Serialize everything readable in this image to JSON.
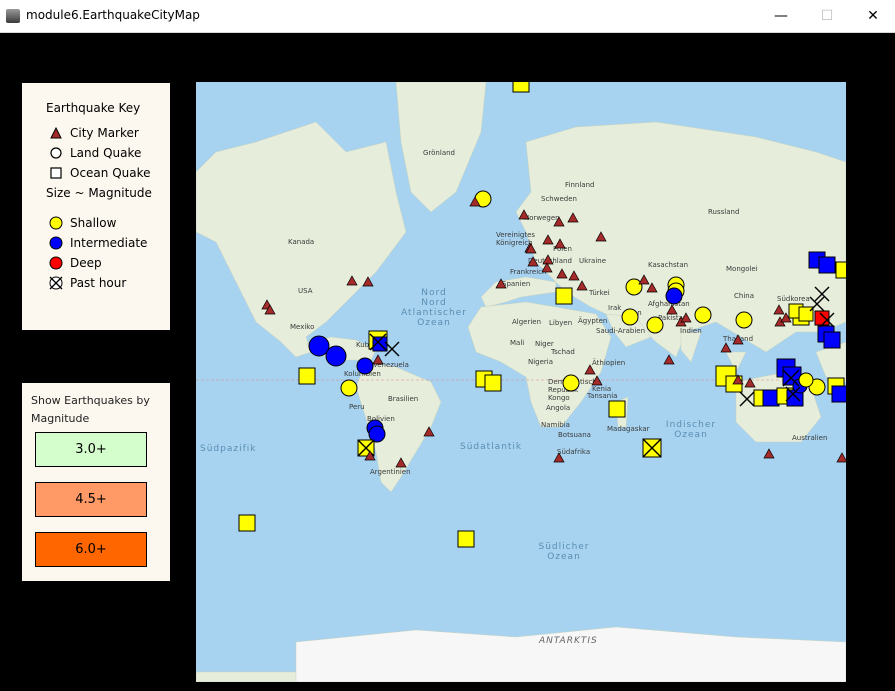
{
  "window": {
    "title": "module6.EarthquakeCityMap",
    "minimize": "—",
    "maximize": "☐",
    "close": "✕"
  },
  "key": {
    "title": "Earthquake Key",
    "city_marker": "City Marker",
    "land_quake": "Land Quake",
    "ocean_quake": "Ocean Quake",
    "size_note": "Size ~ Magnitude",
    "shallow": "Shallow",
    "intermediate": "Intermediate",
    "deep": "Deep",
    "past_hour": "Past hour"
  },
  "filter": {
    "title": "Show Earthquakes by Magnitude",
    "buttons": [
      {
        "label": "3.0+",
        "color": "#d4ffcc"
      },
      {
        "label": "4.5+",
        "color": "#ff9966"
      },
      {
        "label": "6.0+",
        "color": "#ff6600"
      }
    ]
  },
  "colors": {
    "shallow": "#ffff00",
    "intermediate": "#0000ff",
    "deep": "#ff0000",
    "city": "#a52a2a"
  },
  "map": {
    "place_labels": [
      "Grönland",
      "Finnland",
      "Schweden",
      "Norwegen",
      "Vereinigtes Königreich",
      "Polen",
      "Deutschland",
      "Ukraine",
      "Frankreich",
      "Spanien",
      "Türkei",
      "Kasachstan",
      "Mongolei",
      "Russland",
      "China",
      "Südkorea",
      "Kanada",
      "USA",
      "Mexiko",
      "Kuba",
      "Kolumbien",
      "Venezuela",
      "Peru",
      "Brasilien",
      "Bolivien",
      "Argentinien",
      "Algerien",
      "Libyen",
      "Ägypten",
      "Irak",
      "Iran",
      "Afghanistan",
      "Pakistan",
      "Saudi-Arabien",
      "Indien",
      "Thailand",
      "Mali",
      "Niger",
      "Tschad",
      "Nigeria",
      "Äthiopien",
      "Demokratische Republik Kongo",
      "Kenia",
      "Tansania",
      "Angola",
      "Namibia",
      "Botsuana",
      "Madagaskar",
      "Südafrika",
      "Australien"
    ],
    "ocean_labels": [
      "Nord Atlantischer Ozean",
      "Südatlantik",
      "Südpazifik",
      "Indischer Ozean",
      "Südlicher Ozean",
      "Nord",
      "ANTARKTIS"
    ]
  }
}
